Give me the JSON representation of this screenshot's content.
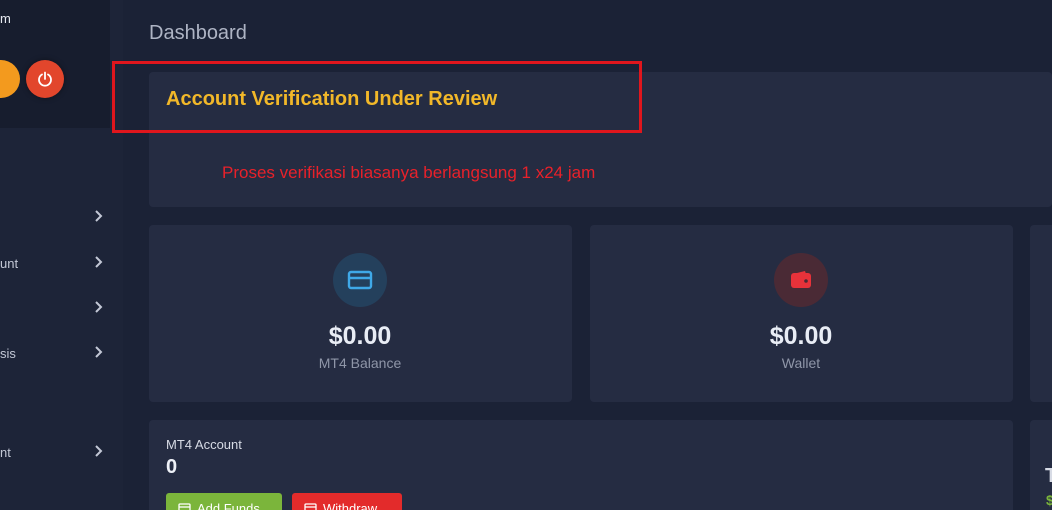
{
  "sidebar": {
    "user_name": "m",
    "items": [
      {
        "label": ""
      },
      {
        "label": "unt"
      },
      {
        "label": ""
      },
      {
        "label": "sis"
      },
      {
        "label": "nt"
      }
    ]
  },
  "header": {
    "title": "Dashboard"
  },
  "alert": {
    "title": "Account Verification Under Review",
    "annotation": "Proses verifikasi biasanya berlangsung 1 x24 jam"
  },
  "stats": [
    {
      "value": "$0.00",
      "label": "MT4 Balance",
      "icon": "card-icon",
      "color": "#3fa9e8"
    },
    {
      "value": "$0.00",
      "label": "Wallet",
      "icon": "wallet-icon",
      "color": "#e8323a"
    }
  ],
  "account": {
    "label": "MT4 Account",
    "value": "0",
    "add_funds_label": "Add Funds",
    "withdraw_label": "Withdraw"
  },
  "right_panel": {
    "letter": "T",
    "dollar": "$"
  },
  "colors": {
    "accent": "#f2b829",
    "annotation_red": "#e8212a",
    "background": "#1b2236"
  }
}
